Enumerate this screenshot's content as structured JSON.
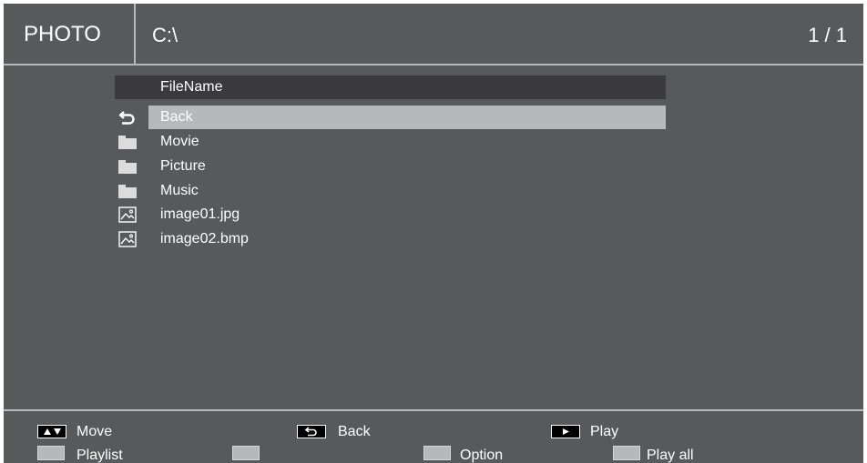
{
  "header": {
    "mode_title": "PHOTO",
    "path": "C:\\",
    "page_count": "1 / 1"
  },
  "file_list": {
    "column_header": "FileName",
    "items": [
      {
        "label": "Back",
        "icon": "back-arrow-icon",
        "selected": true
      },
      {
        "label": "Movie",
        "icon": "folder-icon",
        "selected": false
      },
      {
        "label": "Picture",
        "icon": "folder-icon",
        "selected": false
      },
      {
        "label": "Music",
        "icon": "folder-icon",
        "selected": false
      },
      {
        "label": "image01.jpg",
        "icon": "image-file-icon",
        "selected": false
      },
      {
        "label": "image02.bmp",
        "icon": "image-file-icon",
        "selected": false
      }
    ]
  },
  "footer": {
    "move_label": "Move",
    "back_label": "Back",
    "play_label": "Play",
    "playlist_label": "Playlist",
    "option_label": "Option",
    "play_all_label": "Play all"
  },
  "colors": {
    "background": "#58595b",
    "selection": "#b7b8ba",
    "list_header": "#3a3a3c"
  }
}
